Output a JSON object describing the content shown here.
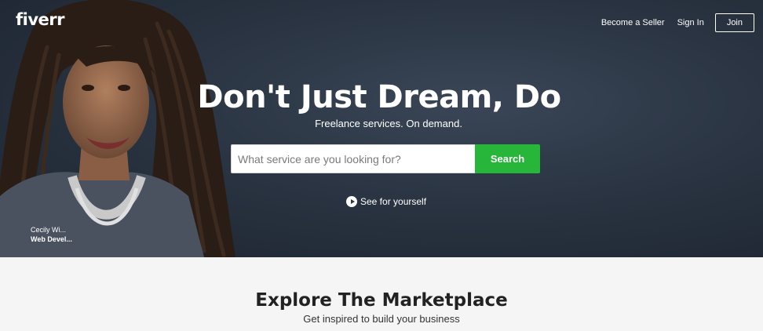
{
  "brand": {
    "logo": "fiverr"
  },
  "nav": {
    "become_seller": "Become a Seller",
    "sign_in": "Sign In",
    "join": "Join"
  },
  "hero": {
    "headline": "Don't Just Dream, Do",
    "subline": "Freelance services. On demand.",
    "search_placeholder": "What service are you looking for?",
    "search_value": "",
    "search_button": "Search",
    "video_link": "See for yourself",
    "caption_name": "Cecily Wi...",
    "caption_role": "Web Devel...",
    "accent_color": "#27b53a"
  },
  "explore": {
    "title": "Explore The Marketplace",
    "subtitle": "Get inspired to build your business"
  }
}
